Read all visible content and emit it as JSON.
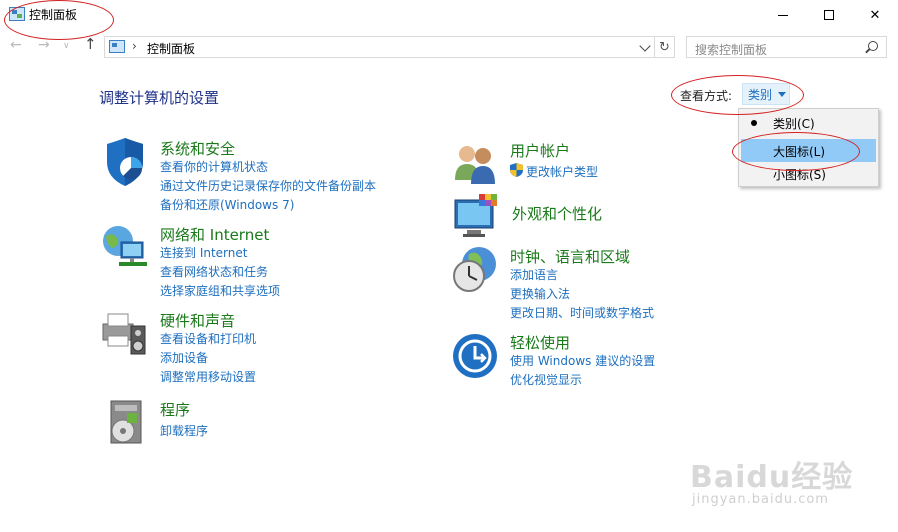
{
  "window": {
    "title": "控制面板",
    "min_glyph": "",
    "max_glyph": "",
    "close_glyph": "✕"
  },
  "nav": {
    "back_glyph": "←",
    "forward_glyph": "→",
    "recent_glyph": "∨",
    "up_glyph": "↑",
    "address_sep": "›",
    "address": "控制面板",
    "refresh_glyph": "↻",
    "search_placeholder": "搜索控制面板"
  },
  "heading": "调整计算机的设置",
  "view": {
    "label": "查看方式:",
    "value": "类别",
    "options": [
      "类别(C)",
      "大图标(L)",
      "小图标(S)"
    ],
    "selected_index": 0,
    "highlighted_index": 1
  },
  "categories": {
    "system": {
      "title": "系统和安全",
      "links": [
        "查看你的计算机状态",
        "通过文件历史记录保存你的文件备份副本",
        "备份和还原(Windows 7)"
      ]
    },
    "network": {
      "title": "网络和 Internet",
      "links": [
        "连接到 Internet",
        "查看网络状态和任务",
        "选择家庭组和共享选项"
      ]
    },
    "hardware": {
      "title": "硬件和声音",
      "links": [
        "查看设备和打印机",
        "添加设备",
        "调整常用移动设置"
      ]
    },
    "programs": {
      "title": "程序",
      "links": [
        "卸载程序"
      ]
    },
    "users": {
      "title": "用户帐户",
      "links": [
        "更改帐户类型"
      ]
    },
    "appearance": {
      "title": "外观和个性化",
      "links": []
    },
    "clock": {
      "title": "时钟、语言和区域",
      "links": [
        "添加语言",
        "更换输入法",
        "更改日期、时间或数字格式"
      ]
    },
    "ease": {
      "title": "轻松使用",
      "links": [
        "使用 Windows 建议的设置",
        "优化视觉显示"
      ]
    }
  },
  "watermark": {
    "main": "Baidu经验",
    "sub": "jingyan.baidu.com"
  },
  "colors": {
    "category_title": "#1a7a1a",
    "link": "#1e6fbf",
    "heading": "#1e3287",
    "menu_highlight": "#91c9f7",
    "annotation": "#d42020"
  }
}
